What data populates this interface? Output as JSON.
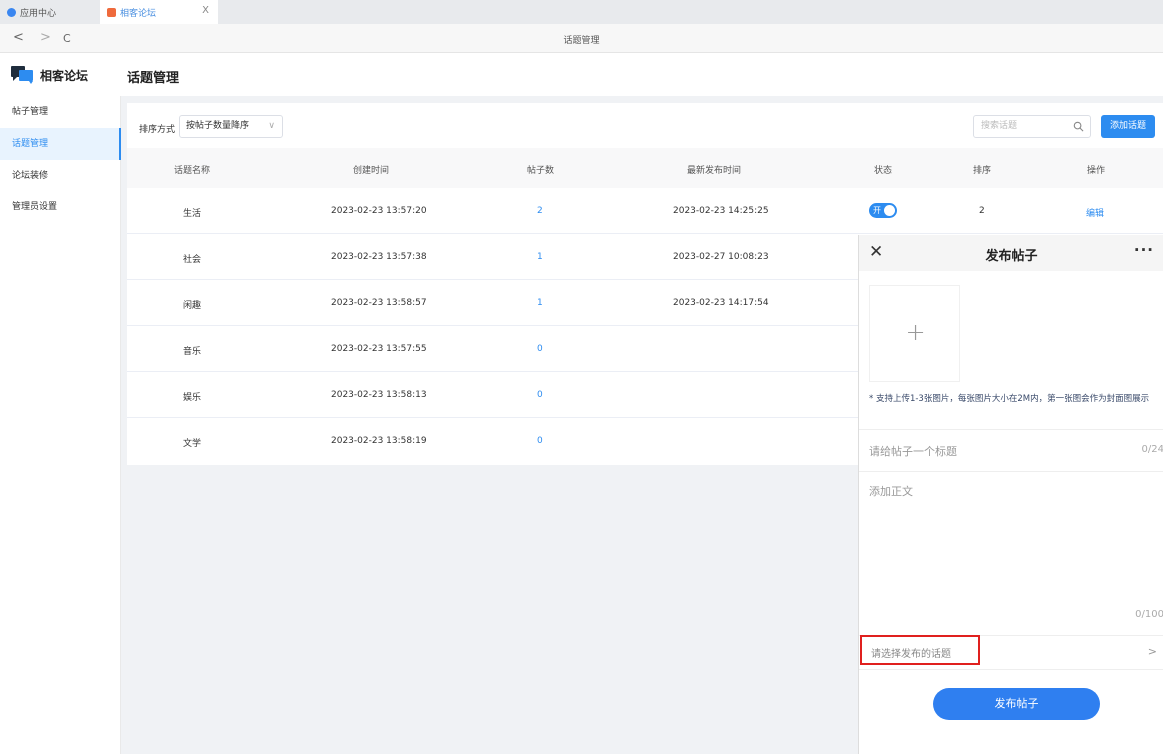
{
  "browser": {
    "tabs": [
      {
        "label": "应用中心",
        "color": "#3a86f0"
      },
      {
        "label": "相客论坛",
        "color": "#ef6a3c"
      }
    ],
    "tab_close": "X",
    "nav": {
      "back": "<",
      "forward": ">",
      "reload": "C"
    },
    "title": "话题管理"
  },
  "app": {
    "name": "相客论坛",
    "page_title": "话题管理"
  },
  "sidebar": {
    "items": [
      {
        "label": "帖子管理",
        "active": false
      },
      {
        "label": "话题管理",
        "active": true
      },
      {
        "label": "论坛装修",
        "active": false
      },
      {
        "label": "管理员设置",
        "active": false
      }
    ]
  },
  "toolbar": {
    "sort_label": "排序方式",
    "sort_value": "按帖子数量降序",
    "search_placeholder": "搜索话题",
    "add_button": "添加话题"
  },
  "table": {
    "headers": [
      "话题名称",
      "创建时间",
      "帖子数",
      "最新发布时间",
      "状态",
      "排序",
      "操作"
    ],
    "rows": [
      {
        "name": "生活",
        "created": "2023-02-23 13:57:20",
        "posts": "2",
        "latest": "2023-02-23 14:25:25",
        "status": "开",
        "order": "2",
        "action": "编辑"
      },
      {
        "name": "社会",
        "created": "2023-02-23 13:57:38",
        "posts": "1",
        "latest": "2023-02-27 10:08:23"
      },
      {
        "name": "闲趣",
        "created": "2023-02-23 13:58:57",
        "posts": "1",
        "latest": "2023-02-23 14:17:54"
      },
      {
        "name": "音乐",
        "created": "2023-02-23 13:57:55",
        "posts": "0",
        "latest": ""
      },
      {
        "name": "娱乐",
        "created": "2023-02-23 13:58:13",
        "posts": "0",
        "latest": ""
      },
      {
        "name": "文学",
        "created": "2023-02-23 13:58:19",
        "posts": "0",
        "latest": ""
      }
    ]
  },
  "publish": {
    "title": "发布帖子",
    "close": "✕",
    "more": "···",
    "add": "+",
    "upload_hint": "* 支持上传1-3张图片，每张图片大小在2M内，第一张图会作为封面图展示",
    "title_placeholder": "请给帖子一个标题",
    "title_count": "0/24",
    "body_placeholder": "添加正文",
    "body_count": "0/100",
    "topic_placeholder": "请选择发布的话题",
    "topic_arrow": ">",
    "submit": "发布帖子"
  },
  "colors": {
    "accent": "#2d8cf0",
    "highlight": "#e0201e"
  }
}
